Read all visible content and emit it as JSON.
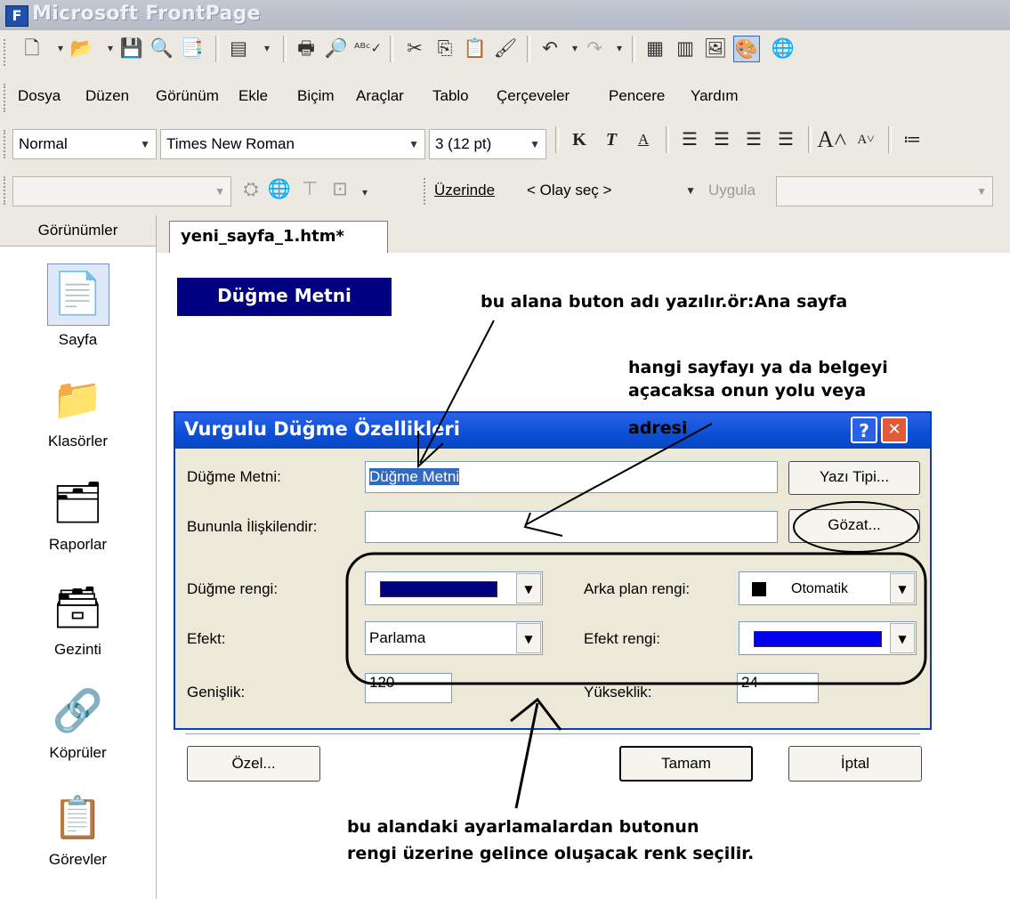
{
  "window": {
    "title": "Microsoft FrontPage"
  },
  "menu": [
    "Dosya",
    "Düzen",
    "Görünüm",
    "Ekle",
    "Biçim",
    "Araçlar",
    "Tablo",
    "Çerçeveler",
    "Pencere",
    "Yardım"
  ],
  "format_bar": {
    "style": "Normal",
    "font": "Times New Roman",
    "size": "3 (12 pt)",
    "bold": "K",
    "italic": "T",
    "underline": "A"
  },
  "dhtml_bar": {
    "on_label": "Üzerinde",
    "event": "< Olay seç >",
    "apply": "Uygula"
  },
  "views": {
    "header": "Görünümler",
    "items": [
      "Sayfa",
      "Klasörler",
      "Raporlar",
      "Gezinti",
      "Köprüler",
      "Görevler"
    ]
  },
  "document": {
    "tab": "yeni_sayfa_1.htm*",
    "button_text": "Düğme Metni"
  },
  "annotations": {
    "name_hint": "bu alana buton adı yazılır.ör:Ana sayfa",
    "link_hint_1": "hangi sayfayı ya da belgeyi",
    "link_hint_2": "açacaksa onun yolu veya",
    "link_hint_3": "adresi",
    "color_hint_1": "bu alandaki ayarlamalardan butonun",
    "color_hint_2": "rengi üzerine gelince oluşacak renk seçilir."
  },
  "dialog": {
    "title": "Vurgulu Düğme Özellikleri",
    "help": "?",
    "close": "✕",
    "text_label": "Düğme Metni:",
    "text_value": "Düğme Metni",
    "font_button": "Yazı Tipi...",
    "link_label": "Bununla İlişkilendir:",
    "link_value": "",
    "browse_button": "Gözat...",
    "button_color_label": "Düğme rengi:",
    "button_color": "#000080",
    "bg_color_label": "Arka plan rengi:",
    "bg_color_value": "Otomatik",
    "effect_label": "Efekt:",
    "effect_value": "Parlama",
    "effect_color_label": "Efekt rengi:",
    "effect_color": "#0000ee",
    "width_label": "Genişlik:",
    "width_value": "120",
    "height_label": "Yükseklik:",
    "height_value": "24",
    "custom_button": "Özel...",
    "ok_button": "Tamam",
    "cancel_button": "İptal"
  }
}
